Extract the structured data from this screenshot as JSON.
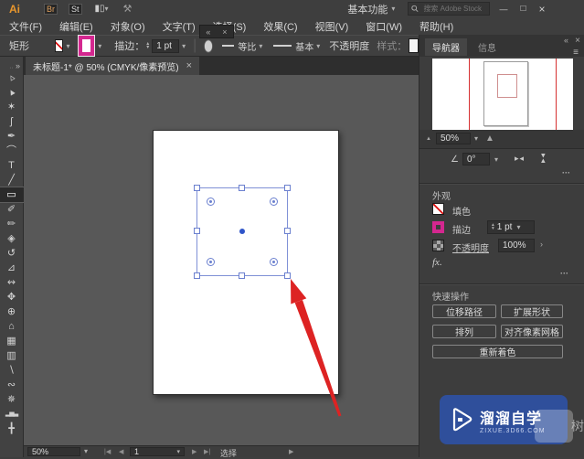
{
  "colors": {
    "accent_magenta": "#d4278f",
    "selection_blue": "#7487d6",
    "arrow_red": "#dd2323",
    "watermark_blue": "#2f4f9b",
    "canvas_gray": "#585858"
  },
  "icons": {
    "chevron_down": "▾",
    "stepper_up": "▴",
    "stepper_down": "▾",
    "collapse_left": "«",
    "collapse_right": "»",
    "close": "×",
    "minimize": "—",
    "maximize": "□",
    "menu": "≡",
    "more": "···",
    "angle": "∠",
    "flip_h": "▸◂",
    "first": "|◀",
    "prev": "◀",
    "next": "▶",
    "last": "▶|",
    "menu_arrow": "▶",
    "mountain": "▲",
    "separator": "|",
    "brush_circle": "●",
    "grip": "··"
  },
  "app": {
    "logo": "Ai",
    "badge_br": "Br",
    "badge_st": "St",
    "workspace": "基本功能",
    "search_placeholder": "搜索 Adobe Stock"
  },
  "menubar": {
    "items": [
      "文件(F)",
      "编辑(E)",
      "对象(O)",
      "文字(T)",
      "选择(S)",
      "效果(C)",
      "视图(V)",
      "窗口(W)",
      "帮助(H)"
    ]
  },
  "controlbar": {
    "object_label": "矩形",
    "stroke_label": "描边：",
    "stroke_width": "1 pt",
    "profile": "等比",
    "brush": "基本",
    "opacity_label": "不透明度",
    "style_label": "样式："
  },
  "doc_tab": {
    "title": "未标题-1* @ 50% (CMYK/像素预览)",
    "close": "×"
  },
  "tools": [
    {
      "name": "selection",
      "glyph": "▹"
    },
    {
      "name": "direct-selection",
      "glyph": "▸"
    },
    {
      "name": "magic-wand",
      "glyph": "✶"
    },
    {
      "name": "lasso",
      "glyph": "ʃ"
    },
    {
      "name": "pen",
      "glyph": "✒"
    },
    {
      "name": "curvature",
      "glyph": "⌒"
    },
    {
      "name": "type",
      "glyph": "T"
    },
    {
      "name": "line-segment",
      "glyph": "╱"
    },
    {
      "name": "rectangle",
      "glyph": "▭"
    },
    {
      "name": "paintbrush",
      "glyph": "✐"
    },
    {
      "name": "pencil",
      "glyph": "✏"
    },
    {
      "name": "eraser",
      "glyph": "◈"
    },
    {
      "name": "rotate",
      "glyph": "↺"
    },
    {
      "name": "scale",
      "glyph": "⊿"
    },
    {
      "name": "width",
      "glyph": "↭"
    },
    {
      "name": "puppet-warp",
      "glyph": "✥"
    },
    {
      "name": "shape-builder",
      "glyph": "⊕"
    },
    {
      "name": "perspective-grid",
      "glyph": "⌂"
    },
    {
      "name": "mesh",
      "glyph": "▦"
    },
    {
      "name": "gradient",
      "glyph": "▥"
    },
    {
      "name": "eyedropper",
      "glyph": "∖"
    },
    {
      "name": "blend",
      "glyph": "∾"
    },
    {
      "name": "symbol-sprayer",
      "glyph": "✵"
    },
    {
      "name": "column-graph",
      "glyph": "▂▅▃"
    },
    {
      "name": "artboard",
      "glyph": "╋"
    }
  ],
  "navigator": {
    "tab_navigator": "导航器",
    "tab_info": "信息",
    "zoom": "50%"
  },
  "transform": {
    "angle_value": "0°"
  },
  "appearance": {
    "title": "外观",
    "fill_label": "填色",
    "stroke_label": "描边",
    "stroke_width": "1 pt",
    "opacity_label": "不透明度",
    "opacity_value": "100%",
    "fx": "fx."
  },
  "quick_actions": {
    "title": "快速操作",
    "buttons": [
      "位移路径",
      "扩展形状",
      "排列",
      "对齐像素网格",
      "重新着色"
    ]
  },
  "watermark": {
    "title": "溜溜自学",
    "subtitle": "zixue.3d66.com",
    "ghost": "树"
  },
  "statusbar": {
    "zoom": "50%",
    "artboard": "1",
    "status": "选择"
  }
}
